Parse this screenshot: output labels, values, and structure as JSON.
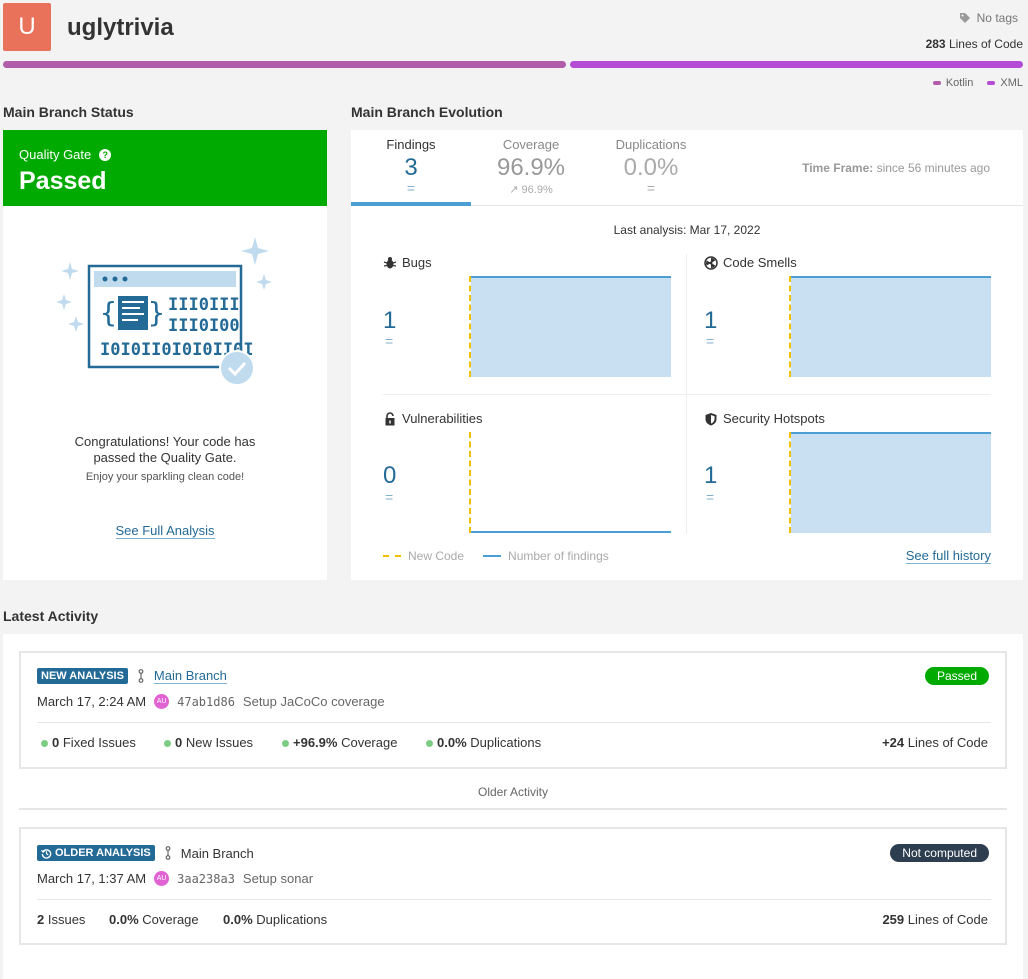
{
  "project": {
    "avatar_letter": "U",
    "name": "uglytrivia",
    "tags": "No tags",
    "loc_value": "283",
    "loc_label": "Lines of Code"
  },
  "languages": [
    {
      "name": "Kotlin",
      "color": "#b15daa"
    },
    {
      "name": "XML",
      "color": "#b44cd6"
    }
  ],
  "status": {
    "heading": "Main Branch Status",
    "qg_label": "Quality Gate",
    "qg_help": "?",
    "qg_value": "Passed",
    "congrats1": "Congratulations! Your code has",
    "congrats2": "passed the Quality Gate.",
    "enjoy": "Enjoy your sparkling clean code!",
    "full_analysis": "See Full Analysis"
  },
  "evolution": {
    "heading": "Main Branch Evolution",
    "tabs": [
      {
        "label": "Findings",
        "value": "3",
        "sub": "="
      },
      {
        "label": "Coverage",
        "value": "96.9%",
        "sub": "↗ 96.9%"
      },
      {
        "label": "Duplications",
        "value": "0.0%",
        "sub": "="
      }
    ],
    "timeframe_label": "Time Frame:",
    "timeframe_value": "since 56 minutes ago",
    "last_analysis": "Last analysis: Mar 17, 2022",
    "cells": [
      {
        "label": "Bugs",
        "value": "1",
        "eq": "=",
        "icon": "bug-icon"
      },
      {
        "label": "Code Smells",
        "value": "1",
        "eq": "=",
        "icon": "code-smell-icon"
      },
      {
        "label": "Vulnerabilities",
        "value": "0",
        "eq": "=",
        "icon": "lock-icon"
      },
      {
        "label": "Security Hotspots",
        "value": "1",
        "eq": "=",
        "icon": "shield-icon"
      }
    ],
    "legend_new_code": "New Code",
    "legend_findings": "Number of findings",
    "full_history": "See full history"
  },
  "activity": {
    "heading": "Latest Activity",
    "new": {
      "badge": "NEW ANALYSIS",
      "branch": "Main Branch",
      "status": "Passed",
      "date": "March 17, 2:24 AM",
      "author": "AU",
      "hash": "47ab1d86",
      "message": "Setup JaCoCo coverage",
      "m1v": "0",
      "m1l": "Fixed Issues",
      "m2v": "0",
      "m2l": "New Issues",
      "m3v": "+96.9%",
      "m3l": "Coverage",
      "m4v": "0.0%",
      "m4l": "Duplications",
      "locv": "+24",
      "locl": "Lines of Code"
    },
    "older_label": "Older Activity",
    "old": {
      "badge": "OLDER ANALYSIS",
      "branch": "Main Branch",
      "status": "Not computed",
      "date": "March 17, 1:37 AM",
      "author": "AU",
      "hash": "3aa238a3",
      "message": "Setup sonar",
      "m1v": "2",
      "m1l": "Issues",
      "m2v": "0.0%",
      "m2l": "Coverage",
      "m3v": "0.0%",
      "m3l": "Duplications",
      "locv": "259",
      "locl": "Lines of Code"
    }
  }
}
